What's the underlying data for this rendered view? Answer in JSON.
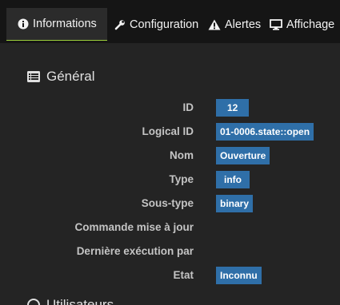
{
  "tabs": [
    {
      "label": "Informations",
      "icon": "info-circle-icon"
    },
    {
      "label": "Configuration",
      "icon": "wrench-icon"
    },
    {
      "label": "Alertes",
      "icon": "warning-icon"
    },
    {
      "label": "Affichage",
      "icon": "monitor-icon"
    }
  ],
  "section": {
    "title": "Général",
    "icon": "list-icon"
  },
  "fields": [
    {
      "label": "ID",
      "value": "12"
    },
    {
      "label": "Logical ID",
      "value": "01-0006.state::open"
    },
    {
      "label": "Nom",
      "value": "Ouverture"
    },
    {
      "label": "Type",
      "value": "info"
    },
    {
      "label": "Sous-type",
      "value": "binary"
    },
    {
      "label": "Commande mise à jour",
      "value": ""
    },
    {
      "label": "Dernière exécution par",
      "value": ""
    },
    {
      "label": "Etat",
      "value": "Inconnu"
    }
  ],
  "section2": {
    "title": "Utilisateurs"
  },
  "colors": {
    "accent": "#9ccf3b",
    "badge": "#2f6fa8",
    "background": "#242424",
    "tabbar": "#151515"
  }
}
